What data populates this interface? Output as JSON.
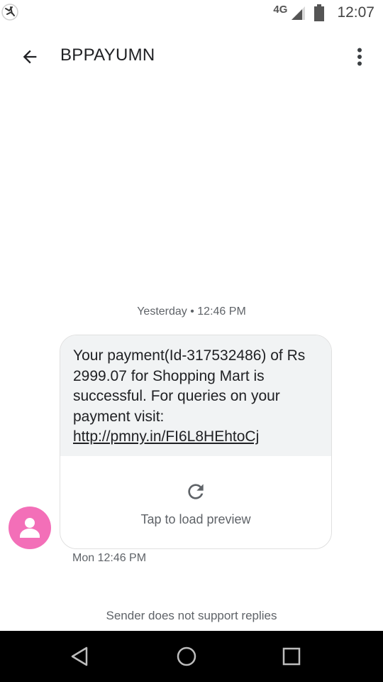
{
  "status_bar": {
    "network": "4G",
    "time": "12:07",
    "icons": [
      "notification-icon",
      "signal-icon",
      "battery-icon"
    ]
  },
  "app_bar": {
    "title": "BPPAYUMN",
    "icons": [
      "back-arrow-icon",
      "more-vert-icon"
    ]
  },
  "thread": {
    "date_header": "Yesterday • 12:46 PM",
    "message": {
      "text": "Your payment(Id-317532486) of Rs 2999.07 for Shopping Mart is successful. For queries on your payment visit:",
      "link": "http://pmny.in/FI6L8HEhtoCj",
      "preview_label": "Tap to load preview",
      "preview_icon": "refresh-icon",
      "timestamp": "Mon 12:46 PM"
    },
    "avatar_icon": "person-icon",
    "avatar_color": "#f36fb8",
    "no_reply_notice": "Sender does not support replies"
  },
  "nav_bar": {
    "icons": [
      "nav-back-icon",
      "nav-home-icon",
      "nav-recents-icon"
    ]
  }
}
